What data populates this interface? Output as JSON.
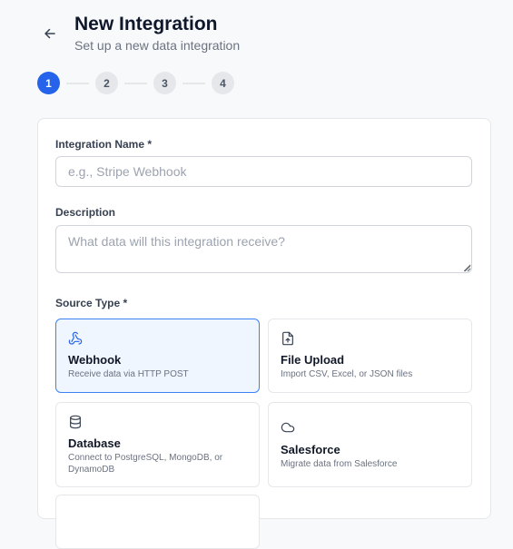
{
  "header": {
    "title": "New Integration",
    "subtitle": "Set up a new data integration"
  },
  "stepper": {
    "steps": [
      "1",
      "2",
      "3",
      "4"
    ],
    "current": 1
  },
  "form": {
    "name": {
      "label": "Integration Name *",
      "placeholder": "e.g., Stripe Webhook",
      "value": ""
    },
    "description": {
      "label": "Description",
      "placeholder": "What data will this integration receive?",
      "value": ""
    },
    "source_type": {
      "label": "Source Type *",
      "selected": "Webhook",
      "options": [
        {
          "title": "Webhook",
          "description": "Receive data via HTTP POST",
          "icon": "webhook-icon"
        },
        {
          "title": "File Upload",
          "description": "Import CSV, Excel, or JSON files",
          "icon": "file-upload-icon"
        },
        {
          "title": "Database",
          "description": "Connect to PostgreSQL, MongoDB, or DynamoDB",
          "icon": "database-icon"
        },
        {
          "title": "Salesforce",
          "description": "Migrate data from Salesforce",
          "icon": "cloud-icon"
        }
      ]
    }
  },
  "colors": {
    "accent": "#2563eb",
    "selected_bg": "#eff6ff",
    "selected_border": "#3b82f6",
    "border": "#e5e7eb",
    "muted_text": "#6b7280"
  }
}
